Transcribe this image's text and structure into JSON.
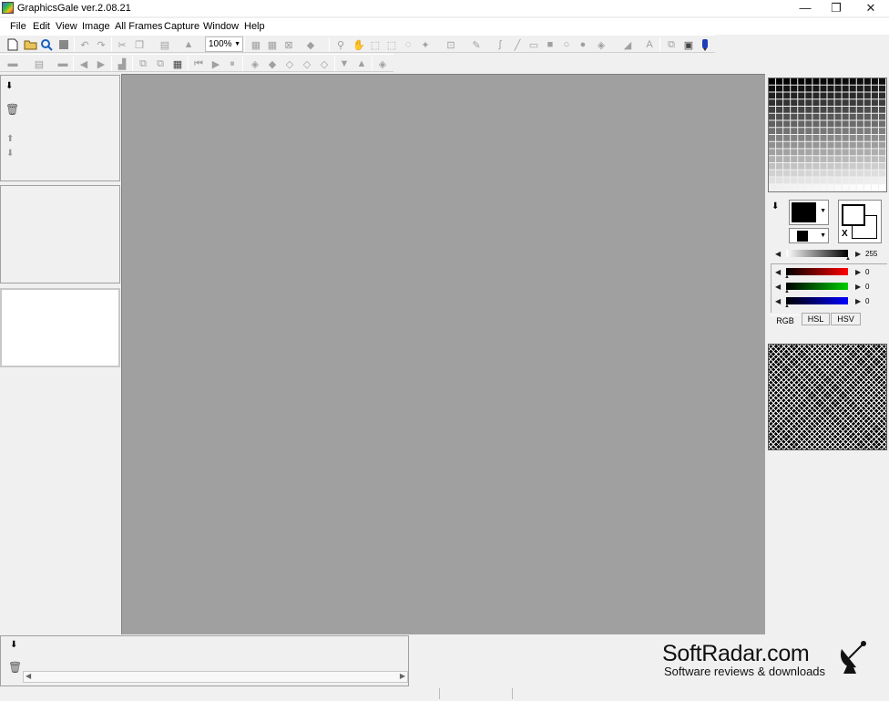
{
  "window": {
    "title": "GraphicsGale ver.2.08.21",
    "minimize": "—",
    "restore": "❐",
    "close": "✕"
  },
  "menu": [
    "File",
    "Edit",
    "View",
    "Image",
    "All Frames",
    "Capture",
    "Window",
    "Help"
  ],
  "toolbar": {
    "zoom_value": "100%"
  },
  "color_panel": {
    "gray_value": "255",
    "red_value": "0",
    "green_value": "0",
    "blue_value": "0",
    "tabs": [
      "RGB",
      "HSL",
      "HSV"
    ],
    "swap_label": "X",
    "colors": {
      "red": "#ff0000",
      "green": "#00cc00",
      "blue": "#0000ff",
      "canvas": "#a0a0a0"
    }
  },
  "watermark": {
    "name": "SoftRadar.com",
    "tagline": "Software reviews & downloads"
  }
}
